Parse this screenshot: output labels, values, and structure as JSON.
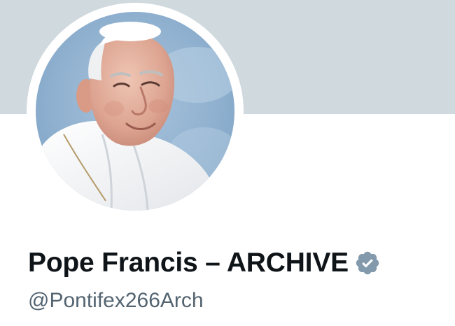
{
  "profile": {
    "display_name": "Pope Francis – ARCHIVE",
    "handle": "@Pontifex266Arch",
    "verified": true
  },
  "icons": {
    "verified_badge": "verified-badge-icon",
    "avatar": "profile-photo"
  },
  "colors": {
    "banner": "#cfd9de",
    "verified_badge": "#829aab",
    "name_text": "#0f1419",
    "handle_text": "#536471",
    "background": "#ffffff"
  }
}
